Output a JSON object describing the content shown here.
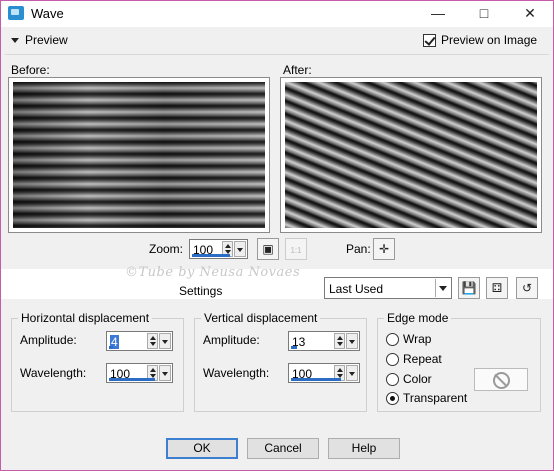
{
  "window": {
    "title": "Wave",
    "minimize": "—",
    "maximize": "□",
    "close": "✕"
  },
  "preview": {
    "toggle_label": "Preview",
    "preview_on_image_label": "Preview on Image",
    "preview_on_image_checked": true,
    "before_label": "Before:",
    "after_label": "After:"
  },
  "zoom": {
    "label": "Zoom:",
    "value": "100",
    "fit_icon": "fit-to-window-icon",
    "actual_size_icon": "actual-size-icon",
    "actual_size_text": "1:1",
    "pan_label": "Pan:",
    "pan_icon": "✛"
  },
  "settings": {
    "watermark": "©Tube by Neusa Novaes",
    "label": "Settings",
    "preset_value": "Last Used",
    "save_icon": "save-preset-icon",
    "randomize_icon": "randomize-icon",
    "reset_icon": "reset-icon"
  },
  "horizontal": {
    "title": "Horizontal displacement",
    "amplitude_label": "Amplitude:",
    "amplitude_value": "4",
    "wavelength_label": "Wavelength:",
    "wavelength_value": "100"
  },
  "vertical": {
    "title": "Vertical displacement",
    "amplitude_label": "Amplitude:",
    "amplitude_value": "13",
    "wavelength_label": "Wavelength:",
    "wavelength_value": "100"
  },
  "edge": {
    "title": "Edge mode",
    "options": [
      "Wrap",
      "Repeat",
      "Color",
      "Transparent"
    ],
    "selected": "Transparent"
  },
  "buttons": {
    "ok": "OK",
    "cancel": "Cancel",
    "help": "Help"
  }
}
